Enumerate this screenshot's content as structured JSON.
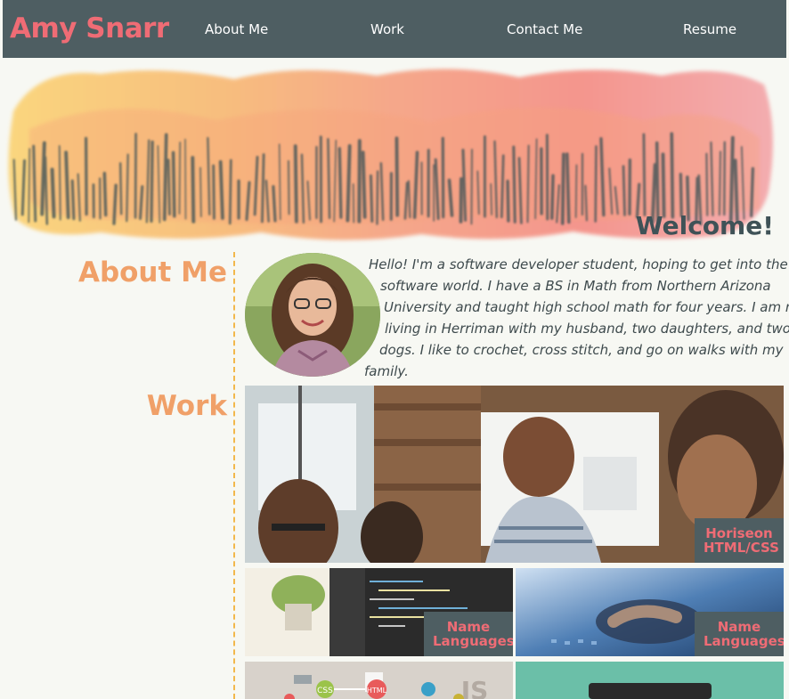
{
  "header": {
    "brand": "Amy Snarr",
    "nav": [
      "About Me",
      "Work",
      "Contact Me",
      "Resume"
    ]
  },
  "hero": {
    "welcome": "Welcome!"
  },
  "about": {
    "heading": "About Me",
    "bio_lines": [
      "Hello! I'm a software developer student, hoping to get into the",
      "software world. I have a BS in Math from Northern Arizona",
      "University and taught high school math for four years. I am now",
      "living in Herriman with my husband, two daughters, and two",
      "dogs. I like to crochet, cross stitch, and go on walks with my",
      "family."
    ]
  },
  "work": {
    "heading": "Work",
    "projects": [
      {
        "line1": "Horiseon",
        "line2": "HTML/CSS"
      },
      {
        "line1": "Name",
        "line2": "Languages"
      },
      {
        "line1": "Name",
        "line2": "Languages"
      }
    ],
    "partial_labels": [
      "CSS",
      "HTML",
      "JS"
    ]
  },
  "colors": {
    "nav_bg": "#4e5e62",
    "brand": "#ef6c75",
    "heading": "#f0a068",
    "divider": "#f2b84b",
    "page_bg": "#f7f8f3"
  }
}
